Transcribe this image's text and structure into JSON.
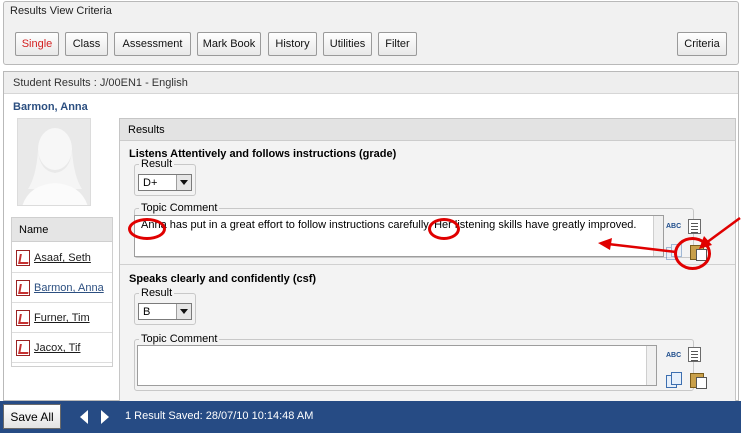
{
  "criteria": {
    "title": "Results View Criteria",
    "buttons": [
      "Single",
      "Class",
      "Assessment",
      "Mark Book",
      "History",
      "Utilities",
      "Filter"
    ],
    "criteria_button": "Criteria",
    "active_color": "#d32020"
  },
  "student_results": {
    "header": "Student Results : J/00EN1 - English",
    "student_name": "Barmon, Anna",
    "name_list": {
      "header": "Name",
      "items": [
        "Asaaf, Seth",
        "Barmon, Anna",
        "Furner, Tim",
        "Jacox, Tif"
      ],
      "selected": "Barmon, Anna"
    }
  },
  "results": {
    "title": "Results",
    "items": [
      {
        "title": "Listens Attentively and follows instructions  (grade)",
        "result_label": "Result",
        "result_value": "D+",
        "comment_label": "Topic Comment",
        "comment_parts": [
          "Anna",
          " has put in a great effort to follow instructions carefully. ",
          "Her",
          " listening skills have greatly improved."
        ]
      },
      {
        "title": "Speaks clearly and confidently  (csf)",
        "result_label": "Result",
        "result_value": "B",
        "comment_label": "Topic Comment",
        "comment_parts": [
          "",
          "",
          "",
          ""
        ]
      }
    ]
  },
  "footer": {
    "save_all": "Save All",
    "status": "1 Result Saved: 28/07/10 10:14:48 AM",
    "background": "#264b84"
  },
  "icons": {
    "spellcheck_text": "ABC",
    "spellcheck": "spellcheck-icon",
    "notes": "document-icon",
    "copy": "copy-icon",
    "paste": "paste-icon"
  },
  "annotation_color": "#e00000"
}
